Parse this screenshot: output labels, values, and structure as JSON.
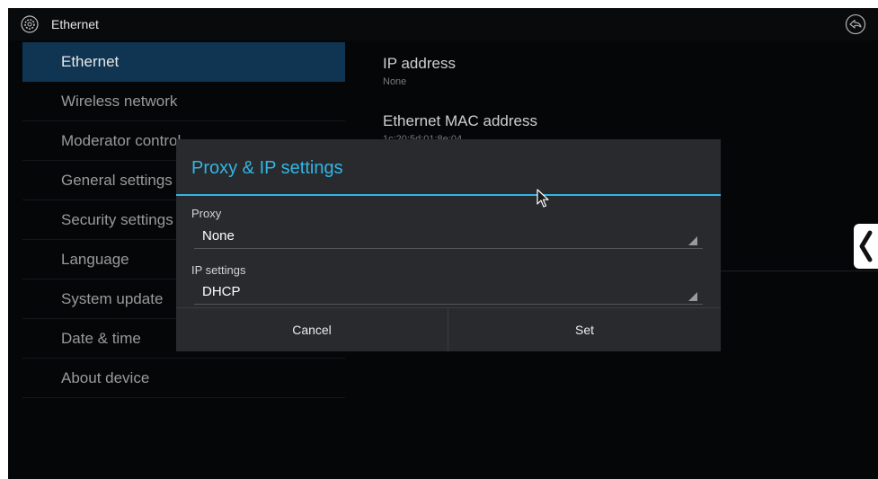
{
  "action_bar": {
    "title": "Ethernet",
    "app_icon": "settings-gear-icon",
    "back_icon": "back-arrow-icon"
  },
  "settings_list": {
    "items": [
      {
        "label": "Ethernet",
        "selected": true
      },
      {
        "label": "Wireless network"
      },
      {
        "label": "Moderator control"
      },
      {
        "label": "General settings"
      },
      {
        "label": "Security settings"
      },
      {
        "label": "Language"
      },
      {
        "label": "System update"
      },
      {
        "label": "Date & time"
      },
      {
        "label": "About device"
      }
    ]
  },
  "detail": {
    "ip_address_title": "IP address",
    "ip_address_value": "None",
    "mac_title": "Ethernet MAC address",
    "mac_value": "1c:20:5d:01:8e:04"
  },
  "dialog": {
    "title": "Proxy & IP settings",
    "proxy_label": "Proxy",
    "proxy_value": "None",
    "ip_label": "IP settings",
    "ip_value": "DHCP",
    "cancel_label": "Cancel",
    "set_label": "Set"
  },
  "colors": {
    "accent": "#33b5e5",
    "selected_item_bg": "#0f3552",
    "dialog_bg": "#282a2d",
    "screen_bg": "#050608"
  }
}
